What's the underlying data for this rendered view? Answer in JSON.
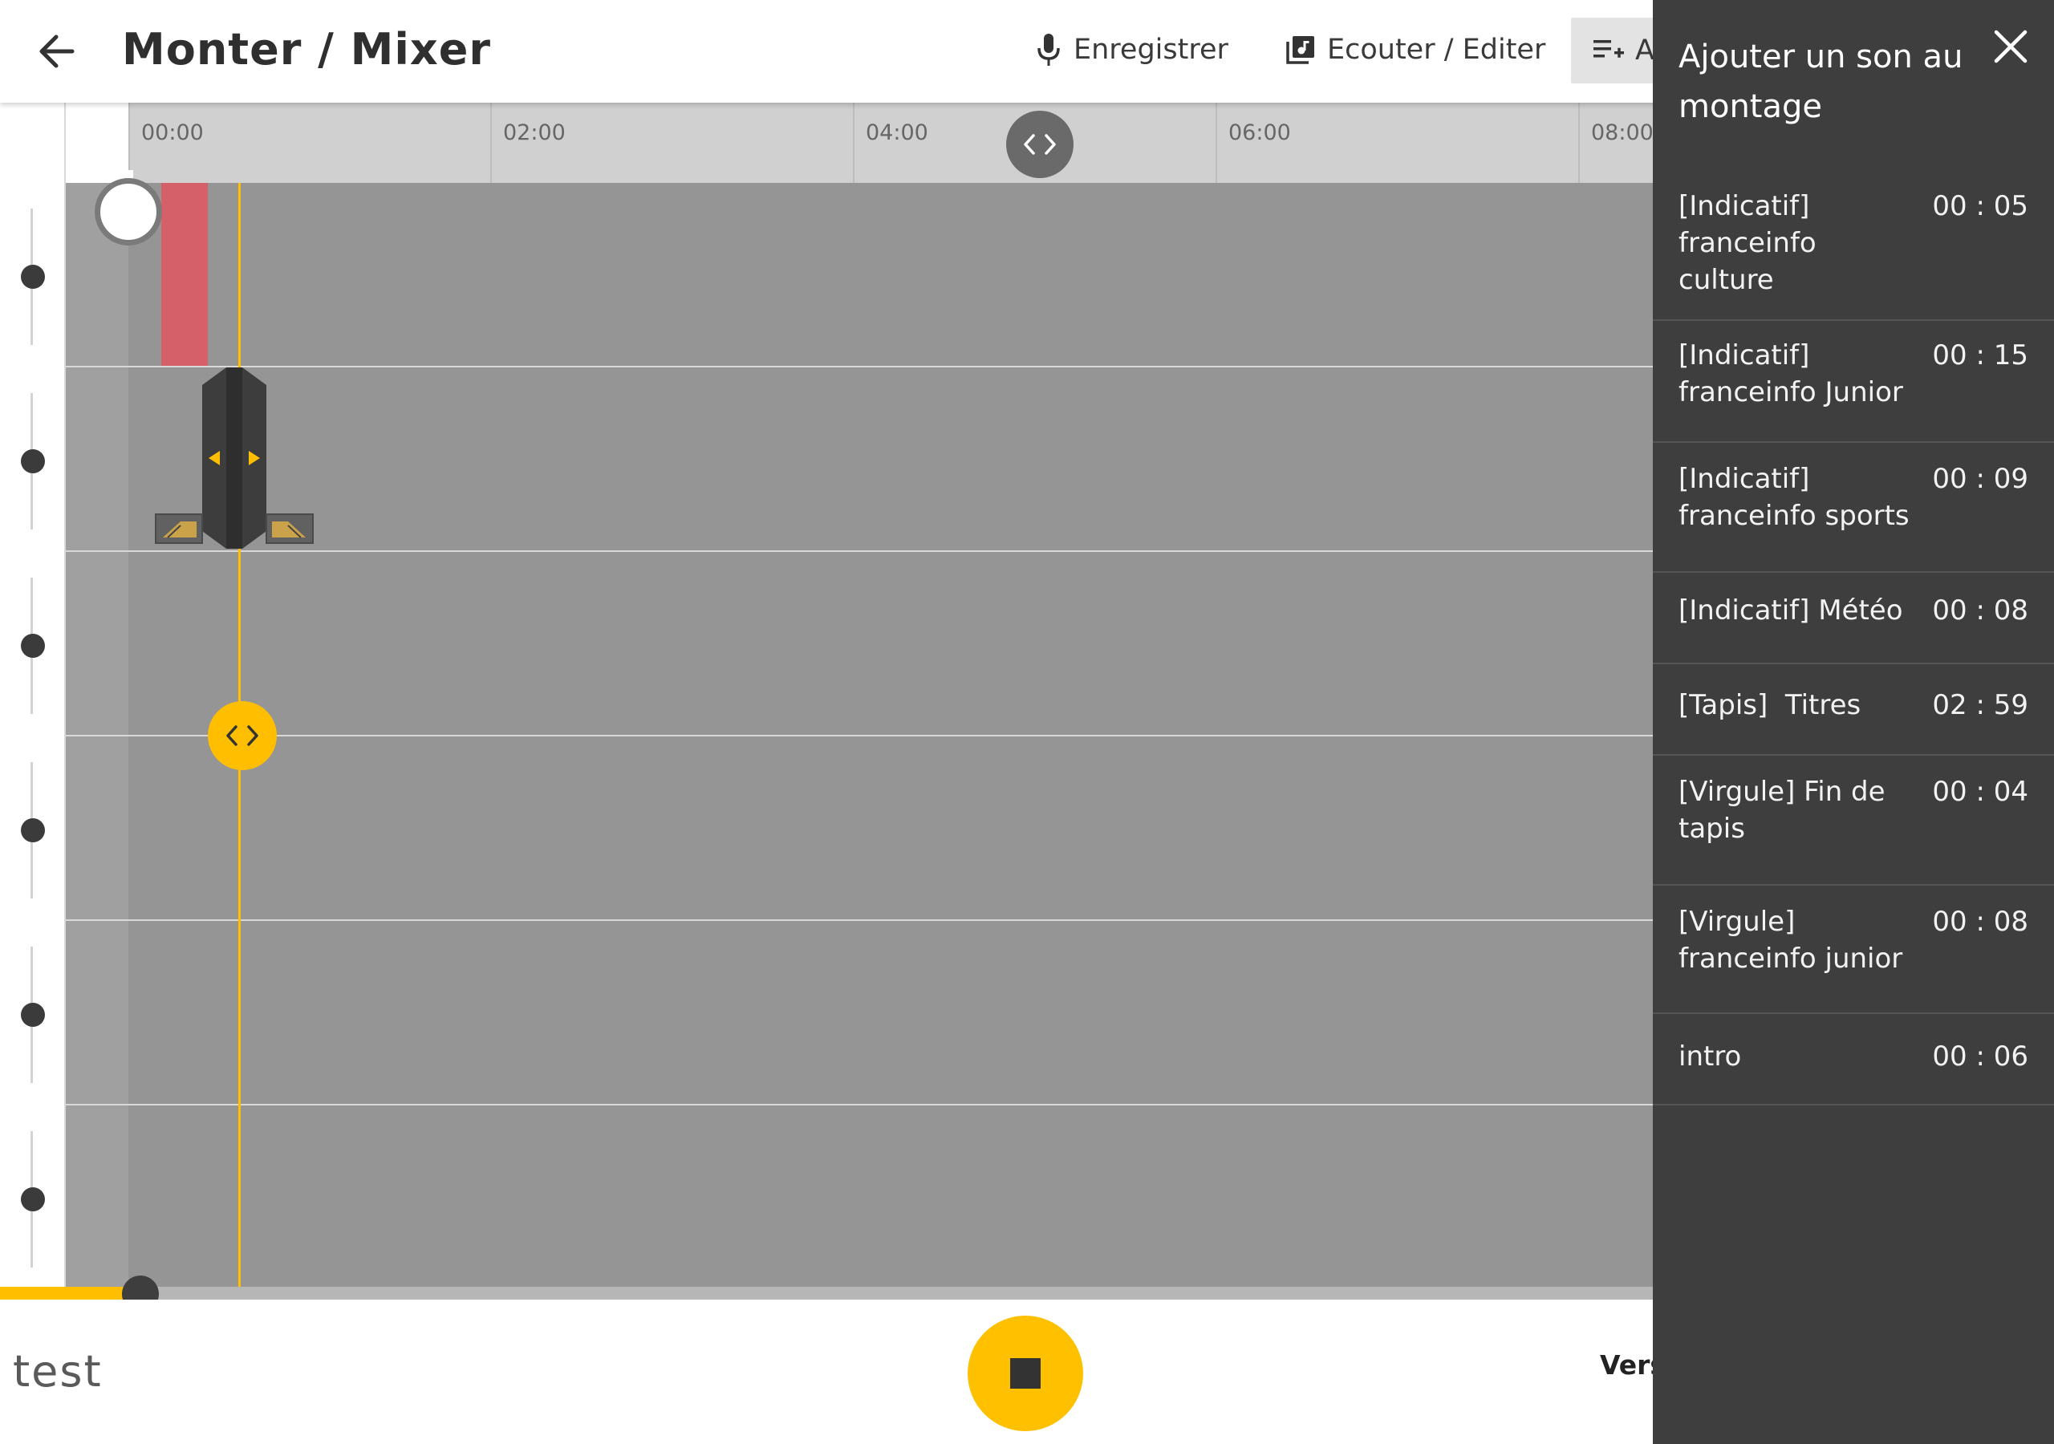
{
  "header": {
    "title": "Monter / Mixer",
    "record_label": "Enregistrer",
    "listen_label": "Ecouter / Editer",
    "add_label": "A"
  },
  "timeline": {
    "ticks": [
      "00:00",
      "02:00",
      "04:00",
      "06:00",
      "08:00"
    ]
  },
  "footer": {
    "project_name": "test",
    "version_label": "Vers"
  },
  "panel": {
    "title": "Ajouter un son au montage",
    "sounds": [
      {
        "name": "[Indicatif] franceinfo culture",
        "duration": "00 : 05"
      },
      {
        "name": "[Indicatif] franceinfo Junior",
        "duration": "00 : 15"
      },
      {
        "name": "[Indicatif] franceinfo sports",
        "duration": "00 : 09"
      },
      {
        "name": "[Indicatif] Météo",
        "duration": "00 : 08"
      },
      {
        "name": "[Tapis]  Titres",
        "duration": "02 : 59"
      },
      {
        "name": "[Virgule] Fin de tapis",
        "duration": "00 : 04"
      },
      {
        "name": "[Virgule] franceinfo junior",
        "duration": "00 : 08"
      },
      {
        "name": "intro",
        "duration": "00 : 06"
      }
    ]
  },
  "colors": {
    "accent": "#ffbf00",
    "clip": "#d5606a",
    "panel_bg": "#3e3e3e",
    "track_bg": "#959595"
  },
  "icons": {
    "back": "arrow-left-icon",
    "record": "microphone-icon",
    "listen": "music-library-icon",
    "add": "playlist-add-icon",
    "close": "close-icon",
    "stop": "stop-icon"
  }
}
